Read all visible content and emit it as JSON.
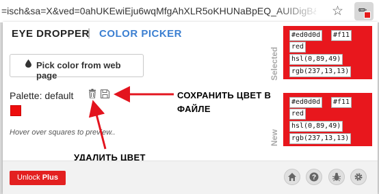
{
  "browser": {
    "url": "=isch&sa=X&ved=0ahUKEwiEju6wqMfgAhXLR5oKHUNaBpEQ_AUIDigB&...",
    "star_icon": "star-icon",
    "extension_icon": "eye-dropper-icon"
  },
  "tabs": {
    "eye_dropper": "EYE DROPPER",
    "separator": "|",
    "color_picker": "COLOR PICKER"
  },
  "pick_button": {
    "label": "Pick color from web page",
    "icon": "drop-icon"
  },
  "palette": {
    "label": "Palette: default",
    "swatch_color": "#ed0d0d"
  },
  "hint": "Hover over squares to preview..",
  "annotations": {
    "save": "СОХРАНИТЬ ЦВЕТ В ФАЙЛЕ",
    "delete": "УДАЛИТЬ ЦВЕТ"
  },
  "selected": {
    "label": "Selected",
    "hex": "#ed0d0d",
    "short": "#f11",
    "name": "red",
    "hsl": "hsl(0,89,49)",
    "rgb": "rgb(237,13,13)"
  },
  "new": {
    "label": "New",
    "hex": "#ed0d0d",
    "short": "#f11",
    "name": "red",
    "hsl": "hsl(0,89,49)",
    "rgb": "rgb(237,13,13)"
  },
  "footer": {
    "unlock_prefix": "Unlock ",
    "unlock_plus": "Plus",
    "icons": [
      "home-icon",
      "help-icon",
      "bug-icon",
      "settings-icon"
    ]
  },
  "colors": {
    "accent_red": "#e8171d",
    "link_blue": "#3b7fd1"
  }
}
